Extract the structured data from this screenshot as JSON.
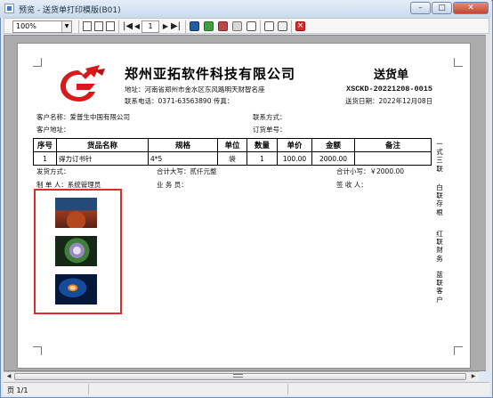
{
  "window": {
    "title": "预览 - 送货单打印模版(B01)",
    "minimize": "–",
    "maximize": "□",
    "close": "✕"
  },
  "toolbar": {
    "zoom": "100%",
    "page_input": "1",
    "first": "|◀",
    "prev": "◀",
    "next": "▶",
    "last": "▶|"
  },
  "document": {
    "company_name": "郑州亚拓软件科技有限公司",
    "address": "地址：河南省郑州市金水区东风路明天财智名座",
    "phone": "联系电话：0371-63563890 传真：",
    "title": "送货单",
    "doc_no": "XSCKD-20221208-0015",
    "date": "送货日期：2022年12月08日",
    "customer_name": "客户名称：爱普生中国有限公司",
    "contact": "联系方式：",
    "customer_address": "客户地址：",
    "order_no": "订货单号：",
    "headers": [
      "序号",
      "货品名称",
      "规格",
      "单位",
      "数量",
      "单价",
      "金额",
      "备注"
    ],
    "rows": [
      [
        "1",
        "得力订书针",
        "4*5",
        "袋",
        "1",
        "100.00",
        "2000.00",
        ""
      ]
    ],
    "delivery": "发货方式：",
    "total_upper": "合计大写：贰仟元整",
    "total_lower": "合计小写：￥2000.00",
    "creator": "制 单 人：系统管理员",
    "salesman": "业 务 员：",
    "receiver": "签 收 人：",
    "side_text_1": "一式三联",
    "side_text_2": "白联存根",
    "side_text_3": "红联财务",
    "side_text_4": "蓝联客户"
  },
  "images": [
    "landscape-photo",
    "hydrangea-photo",
    "jellyfish-photo"
  ],
  "status": {
    "page": "页 1/1"
  },
  "colors": {
    "selection_border": "#e32a2a",
    "window_frame": "#6d8db4",
    "logo_red": "#d71b1b"
  }
}
